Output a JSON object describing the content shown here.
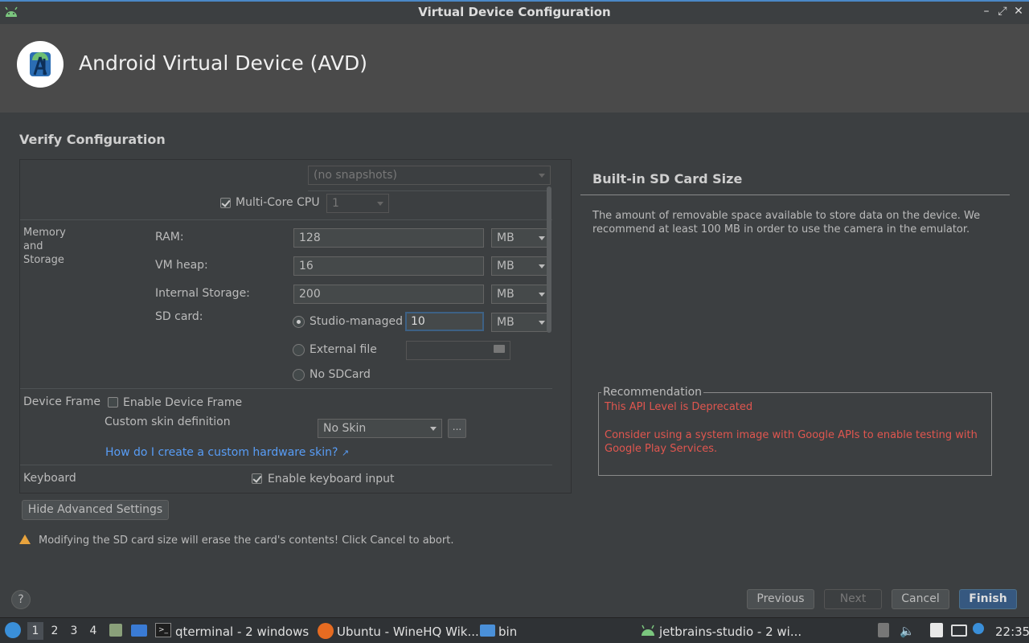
{
  "window": {
    "title": "Virtual Device Configuration"
  },
  "header": {
    "title": "Android Virtual Device (AVD)"
  },
  "section_title": "Verify Configuration",
  "config": {
    "snapshot_select": "(no snapshots)",
    "multicore_label": "Multi-Core CPU",
    "multicore_checked": true,
    "multicore_value": "1",
    "memory_group": "Memory\nand\nStorage",
    "ram_label": "RAM:",
    "ram_value": "128",
    "ram_unit": "MB",
    "vmheap_label": "VM heap:",
    "vmheap_value": "16",
    "vmheap_unit": "MB",
    "internal_label": "Internal Storage:",
    "internal_value": "200",
    "internal_unit": "MB",
    "sdcard_label": "SD card:",
    "sd_studio_label": "Studio-managed",
    "sd_studio_value": "10",
    "sd_studio_unit": "MB",
    "sd_external_label": "External file",
    "sd_none_label": "No SDCard",
    "frame_group": "Device Frame",
    "enable_frame_label": "Enable Device Frame",
    "custom_skin_label": "Custom skin definition",
    "skin_select": "No Skin",
    "skin_browse": "...",
    "skin_help_link": "How do I create a custom hardware skin?",
    "keyboard_group": "Keyboard",
    "keyboard_label": "Enable keyboard input",
    "keyboard_checked": true
  },
  "hide_advanced_button": "Hide Advanced Settings",
  "warning": "Modifying the SD card size will erase the card's contents! Click Cancel to abort.",
  "info": {
    "title": "Built-in SD Card Size",
    "description": "The amount of removable space available to store data on the device. We recommend at least 100 MB in order to use the camera in the emulator."
  },
  "recommendation": {
    "legend": "Recommendation",
    "line1": "This API Level is Deprecated",
    "line2": "Consider using a system image with Google APIs to enable testing with Google Play Services."
  },
  "footer": {
    "help": "?",
    "previous": "Previous",
    "next": "Next",
    "cancel": "Cancel",
    "finish": "Finish"
  },
  "taskbar": {
    "desktops": [
      "1",
      "2",
      "3",
      "4"
    ],
    "task_terminal": "qterminal - 2 windows",
    "task_firefox": "Ubuntu - WineHQ Wik...",
    "task_folder": "bin",
    "task_studio": "jetbrains-studio - 2 wi...",
    "clock": "22:35"
  },
  "colors": {
    "background": "#3c3f41",
    "accent": "#365880",
    "link": "#589df6",
    "error": "#e0564f",
    "warning": "#e8a33d"
  }
}
